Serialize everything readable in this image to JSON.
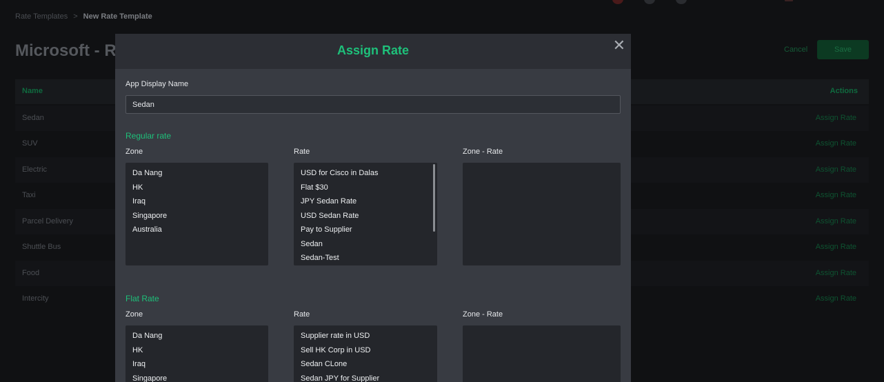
{
  "background": {
    "breadcrumb": {
      "parent": "Rate Templates",
      "separator": ">",
      "current": "New Rate Template"
    },
    "page_title": "Microsoft - Rat",
    "cancel_label": "Cancel",
    "save_label": "Save",
    "table": {
      "headers": {
        "name": "Name",
        "actions": "Actions"
      },
      "rows": [
        {
          "name": "Sedan",
          "action": "Assign Rate"
        },
        {
          "name": "SUV",
          "action": "Assign Rate"
        },
        {
          "name": "Electric",
          "action": "Assign Rate"
        },
        {
          "name": "Taxi",
          "action": "Assign Rate"
        },
        {
          "name": "Parcel Delivery",
          "action": "Assign Rate"
        },
        {
          "name": "Shuttle Bus",
          "action": "Assign Rate"
        },
        {
          "name": "Food",
          "action": "Assign Rate"
        },
        {
          "name": "Intercity",
          "action": "Assign Rate"
        }
      ]
    }
  },
  "modal": {
    "title": "Assign Rate",
    "close_icon": "close-icon",
    "app_display_name_label": "App Display Name",
    "app_display_name_value": "Sedan",
    "regular": {
      "title": "Regular rate",
      "zone_label": "Zone",
      "rate_label": "Rate",
      "zone_rate_label": "Zone - Rate",
      "zones": [
        "Da Nang",
        "HK",
        "Iraq",
        "Singapore",
        "Australia"
      ],
      "rates": [
        "USD for Cisco in Dalas",
        "Flat $30",
        "JPY Sedan Rate",
        "USD Sedan Rate",
        "Pay to Supplier",
        "Sedan",
        "Sedan-Test"
      ]
    },
    "flat": {
      "title": "Flat Rate",
      "zone_label": "Zone",
      "rate_label": "Rate",
      "zone_rate_label": "Zone - Rate",
      "zones": [
        "Da Nang",
        "HK",
        "Iraq",
        "Singapore"
      ],
      "rates": [
        "Supplier rate in USD",
        "Sell HK Corp in USD",
        "Sedan CLone",
        "Sedan JPY for Supplier"
      ]
    }
  }
}
